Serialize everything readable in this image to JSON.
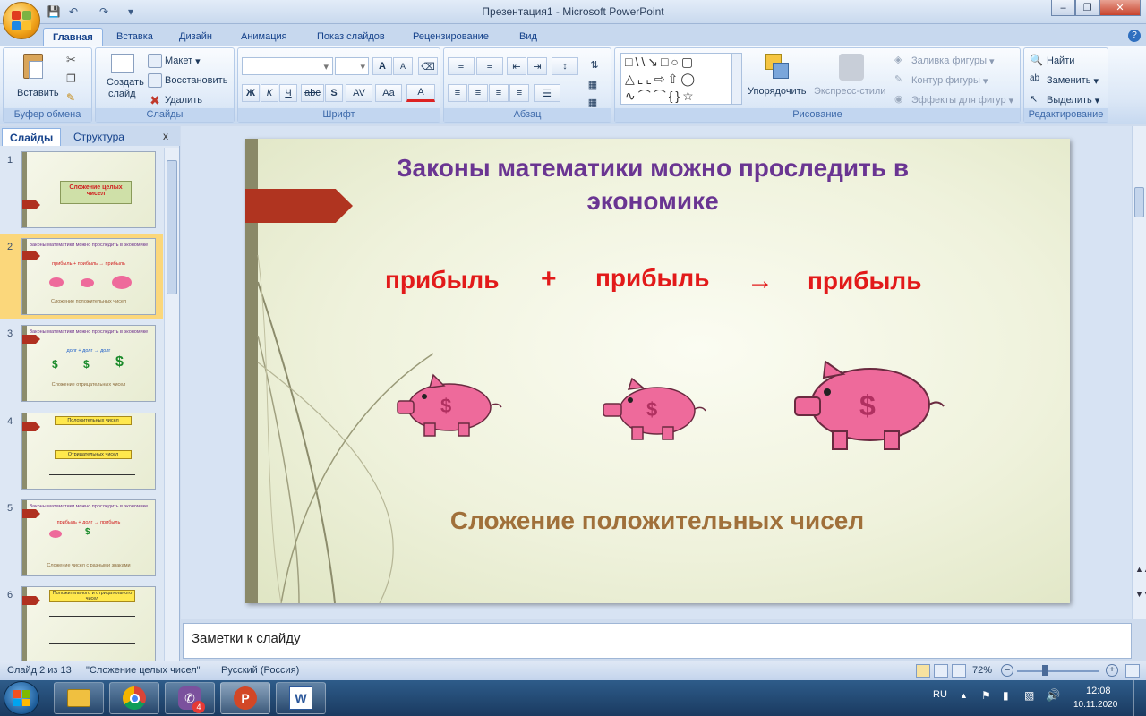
{
  "window": {
    "title": "Презентация1 - Microsoft PowerPoint"
  },
  "tabs": [
    "Главная",
    "Вставка",
    "Дизайн",
    "Анимация",
    "Показ слайдов",
    "Рецензирование",
    "Вид"
  ],
  "ribbon": {
    "clipboard": {
      "paste": "Вставить",
      "label": "Буфер обмена"
    },
    "slides": {
      "create": "Создать",
      "create2": "слайд",
      "layout": "Макет",
      "restore": "Восстановить",
      "delete": "Удалить",
      "label": "Слайды"
    },
    "font": {
      "label": "Шрифт",
      "bold": "Ж",
      "italic": "К",
      "underline": "Ч",
      "strike": "abc",
      "shadow": "S",
      "spacing": "AV",
      "case": "Aa",
      "color": "A",
      "grow": "A",
      "shrink": "A"
    },
    "paragraph": {
      "label": "Абзац"
    },
    "drawing": {
      "arrange": "Упорядочить",
      "quick_styles": "Экспресс-стили",
      "fill": "Заливка фигуры",
      "outline": "Контур фигуры",
      "effects": "Эффекты для фигур",
      "label": "Рисование"
    },
    "editing": {
      "find": "Найти",
      "replace": "Заменить",
      "select": "Выделить",
      "label": "Редактирование"
    }
  },
  "panel": {
    "tab_slides": "Слайды",
    "tab_outline": "Структура",
    "close": "x"
  },
  "thumbnails": [
    {
      "num": "1",
      "title": "Сложение целых чисел"
    },
    {
      "num": "2",
      "title": "Законы математики можно проследить в экономике",
      "line": "прибыль + прибыль → прибыль",
      "caption": "Сложение положительных чисел"
    },
    {
      "num": "3",
      "title": "Законы математики можно проследить в экономике",
      "line": "долг + долг → долг",
      "caption": "Сложение отрицательных чисел"
    },
    {
      "num": "4",
      "title": "Положительных чисел",
      "title2": "Отрицательных чисел"
    },
    {
      "num": "5",
      "title": "Законы математики можно проследить в экономике",
      "line": "прибыль + долг → прибыль",
      "caption": "Сложение чисел с разными знаками"
    },
    {
      "num": "6",
      "title": "Положительного и отрицательного чисел"
    }
  ],
  "slide": {
    "title": "Законы математики можно проследить в экономике",
    "w1": "прибыль",
    "plus": "+",
    "w2": "прибыль",
    "arrow": "→",
    "w3": "прибыль",
    "caption": "Сложение положительных чисел"
  },
  "notes": {
    "placeholder": "Заметки к слайду"
  },
  "status": {
    "slide": "Слайд 2 из 13",
    "theme": "\"Сложение целых чисел\"",
    "lang": "Русский (Россия)",
    "zoom": "72%"
  },
  "taskbar": {
    "lang": "RU",
    "time": "12:08",
    "date": "10.11.2020",
    "viber_badge": "4"
  },
  "colors": {
    "title": "#6a3592",
    "profit": "#e21a1a",
    "caption": "#a0703a",
    "pig": "#ee6a9b"
  }
}
